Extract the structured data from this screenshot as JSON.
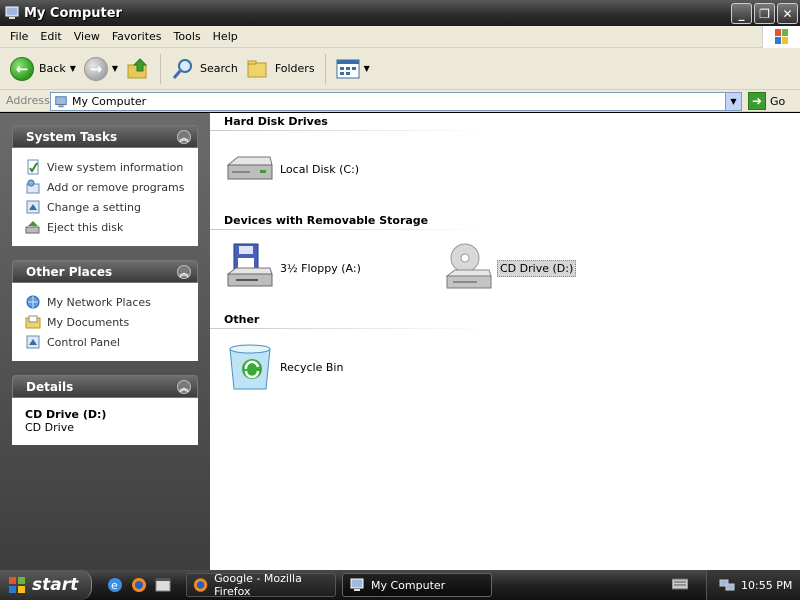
{
  "window": {
    "title": "My Computer"
  },
  "window_buttons": {
    "minimize": "_",
    "maximize": "❐",
    "close": "✕"
  },
  "menu": [
    "File",
    "Edit",
    "View",
    "Favorites",
    "Tools",
    "Help"
  ],
  "toolbar": {
    "back": "Back",
    "search": "Search",
    "folders": "Folders"
  },
  "address": {
    "label": "Address",
    "value": "My Computer",
    "go": "Go"
  },
  "task_pane": {
    "system_tasks": {
      "title": "System Tasks",
      "items": [
        "View system information",
        "Add or remove programs",
        "Change a setting",
        "Eject this disk"
      ]
    },
    "other_places": {
      "title": "Other Places",
      "items": [
        "My Network Places",
        "My Documents",
        "Control Panel"
      ]
    },
    "details": {
      "title": "Details",
      "name": "CD Drive (D:)",
      "type": "CD Drive"
    }
  },
  "content": {
    "groups": [
      {
        "title": "Hard Disk Drives",
        "items": [
          "Local Disk (C:)"
        ]
      },
      {
        "title": "Devices with Removable Storage",
        "items": [
          "3½ Floppy (A:)",
          "CD Drive (D:)"
        ]
      },
      {
        "title": "Other",
        "items": [
          "Recycle Bin"
        ]
      }
    ],
    "selected_item": "CD Drive (D:)"
  },
  "taskbar": {
    "start": "start",
    "tasks": [
      "Google - Mozilla Firefox",
      "My Computer"
    ],
    "active_task": "My Computer",
    "clock": "10:55 PM"
  },
  "colors": {
    "accent_green": "#3d9b2f",
    "selection": "#d6d6d6",
    "pane_dark": "#3e3e3e"
  }
}
